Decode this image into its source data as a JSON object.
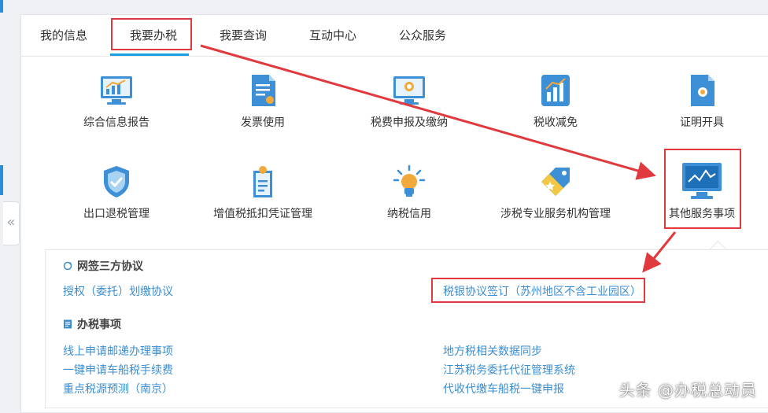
{
  "tabs": [
    {
      "label": "我的信息"
    },
    {
      "label": "我要办税"
    },
    {
      "label": "我要查询"
    },
    {
      "label": "互动中心"
    },
    {
      "label": "公众服务"
    }
  ],
  "services": [
    {
      "label": "综合信息报告",
      "icon": "monitor-chart-icon"
    },
    {
      "label": "发票使用",
      "icon": "invoice-document-icon"
    },
    {
      "label": "税费申报及缴纳",
      "icon": "monitor-declare-icon"
    },
    {
      "label": "税收减免",
      "icon": "bar-chart-icon"
    },
    {
      "label": "证明开具",
      "icon": "certificate-icon"
    },
    {
      "label": "出口退税管理",
      "icon": "shield-check-icon"
    },
    {
      "label": "增值税抵扣凭证管理",
      "icon": "voucher-icon"
    },
    {
      "label": "纳税信用",
      "icon": "lightbulb-icon"
    },
    {
      "label": "涉税专业服务机构管理",
      "icon": "tag-star-icon"
    },
    {
      "label": "其他服务事项",
      "icon": "monitor-line-icon"
    }
  ],
  "sub_panel": {
    "section1": {
      "title": "网签三方协议",
      "links": [
        "授权（委托）划缴协议",
        "税银协议签订（苏州地区不含工业园区）"
      ]
    },
    "section2": {
      "title": "办税事项",
      "links": [
        "线上申请邮递办理事项",
        "地方税相关数据同步",
        "一键申请车船税手续费",
        "江苏税务委托代征管理系统",
        "重点税源预测（南京）",
        "代收代缴车船税一键申报"
      ]
    }
  },
  "collapse_handle": "«",
  "watermark": "头条 @办税总动员",
  "colors": {
    "accent": "#1a9fe0",
    "link": "#3b8ed0",
    "highlight": "#e0393e"
  }
}
